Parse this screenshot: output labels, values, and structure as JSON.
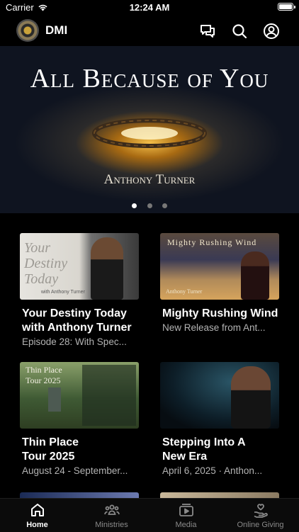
{
  "status_bar": {
    "carrier": "Carrier",
    "time": "12:24 AM"
  },
  "header": {
    "title": "DMI",
    "icons": [
      "chat-icon",
      "search-icon",
      "account-icon"
    ]
  },
  "hero": {
    "title": "All Because of You",
    "author": "Anthony Turner",
    "page_count": 3,
    "active_page": 1
  },
  "cards": [
    {
      "title": "Your Destiny Today with Anthony Turner",
      "subtitle": "Episode 28: With Spec...",
      "thumb_text": "Your Destiny Today",
      "thumb_sub": "with Anthony Turner"
    },
    {
      "title": "Mighty Rushing Wind",
      "subtitle": "New Release from Ant...",
      "thumb_text": "Mighty Rushing Wind",
      "thumb_sub": "Anthony Turner"
    },
    {
      "title": "Thin Place Tour 2025",
      "subtitle": "August 24 - September...",
      "thumb_text": "Thin Place",
      "thumb_sub": "Tour 2025"
    },
    {
      "title": "Stepping Into A New Era",
      "subtitle": "April 6, 2025 · Anthon..."
    }
  ],
  "tabs": [
    {
      "label": "Home",
      "icon": "home-icon",
      "active": true
    },
    {
      "label": "Ministries",
      "icon": "people-icon",
      "active": false
    },
    {
      "label": "Media",
      "icon": "media-icon",
      "active": false
    },
    {
      "label": "Online Giving",
      "icon": "giving-icon",
      "active": false
    }
  ]
}
